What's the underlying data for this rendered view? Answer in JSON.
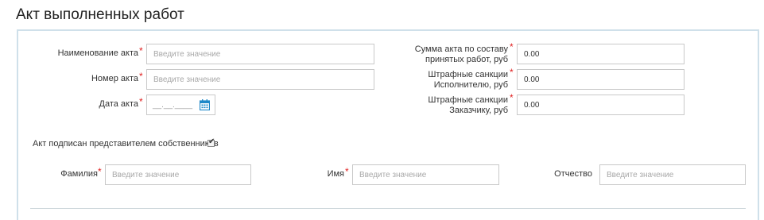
{
  "page": {
    "title": "Акт выполненных работ"
  },
  "form": {
    "placeholder": "Введите значение",
    "required_mark": "*",
    "name": {
      "label": "Наименование акта",
      "value": ""
    },
    "number": {
      "label": "Номер акта",
      "value": ""
    },
    "date": {
      "label": "Дата акта",
      "mask": "__.__.____",
      "icon": "calendar-icon"
    },
    "act_sum": {
      "label_line1": "Сумма акта по составу",
      "label_line2": "принятых работ, руб",
      "value": "0.00"
    },
    "penalty_executor": {
      "label_line1": "Штрафные санкции",
      "label_line2": "Исполнителю, руб",
      "value": "0.00"
    },
    "penalty_customer": {
      "label_line1": "Штрафные санкции",
      "label_line2": "Заказчику, руб",
      "value": "0.00"
    },
    "signed": {
      "label": "Акт подписан представителем собственников",
      "checked": true,
      "check_glyph": "✔"
    },
    "surname": {
      "label": "Фамилия",
      "value": ""
    },
    "first_name": {
      "label": "Имя",
      "value": ""
    },
    "patronymic": {
      "label": "Отчество",
      "value": ""
    }
  },
  "colors": {
    "required": "#e02020",
    "border": "#c9c9c9",
    "panel_border": "#cfe0ea",
    "icon": "#1e88c8"
  }
}
